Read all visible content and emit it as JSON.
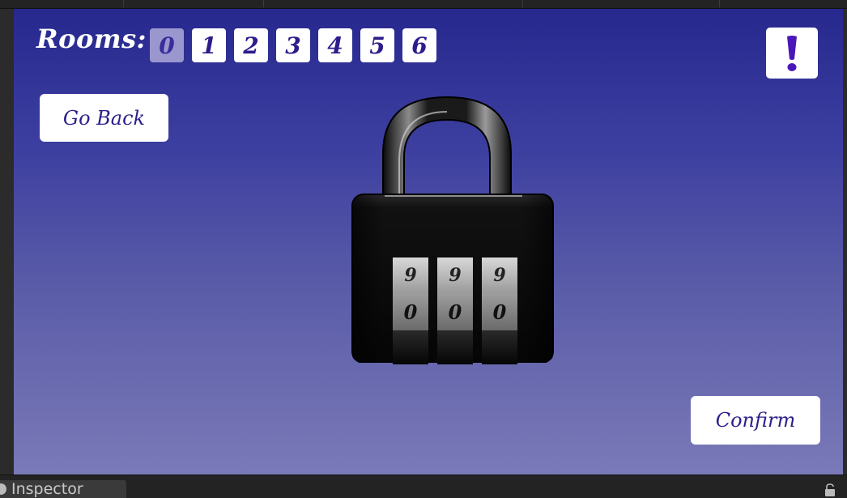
{
  "editor": {
    "inspector_tab": "Inspector"
  },
  "hud": {
    "rooms_label": "Rooms:",
    "rooms": [
      "0",
      "1",
      "2",
      "3",
      "4",
      "5",
      "6"
    ],
    "active_room": "0",
    "alert_symbol": "!",
    "go_back_label": "Go Back",
    "confirm_label": "Confirm"
  },
  "padlock": {
    "dials": [
      {
        "top": "9",
        "current": "0"
      },
      {
        "top": "9",
        "current": "0"
      },
      {
        "top": "9",
        "current": "0"
      }
    ]
  },
  "colors": {
    "button_text": "#2d1c8c",
    "active_room_bg": "#9a97cf",
    "background_top": "#27288e",
    "background_bottom": "#7a79b8"
  }
}
